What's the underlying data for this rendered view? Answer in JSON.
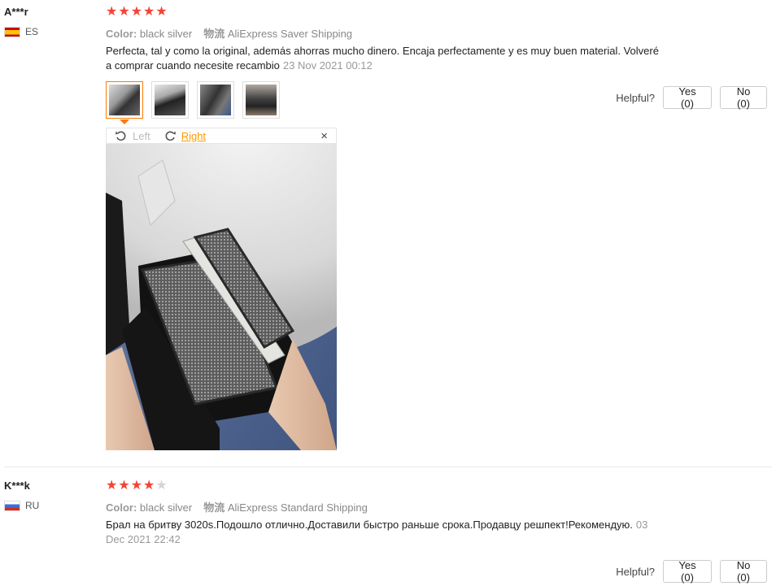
{
  "reviews": [
    {
      "user": "A***r",
      "country": "ES",
      "stars": "★★★★★",
      "stars_off": "",
      "rating": 5,
      "color_label": "Color:",
      "color_value": "black silver",
      "shipping_label": "物流",
      "shipping_value": "AliExpress Saver Shipping",
      "text_line1": "Perfecta, tal y como la original, además ahorras mucho dinero. Encaja perfectamente y es muy buen material. Volveré",
      "text_line2": "a comprar cuando necesite recambio",
      "date": "23 Nov 2021 00:12",
      "helpful_label": "Helpful?",
      "yes_label": "Yes (0)",
      "no_label": "No (0)",
      "viewer": {
        "left_label": "Left",
        "right_label": "Right",
        "close": "×"
      }
    },
    {
      "user": "K***k",
      "country": "RU",
      "stars": "★★★★",
      "stars_off": "★",
      "rating": 4,
      "color_label": "Color:",
      "color_value": "black silver",
      "shipping_label": "物流",
      "shipping_value": "AliExpress Standard Shipping",
      "text_line1": "Брал на бритву 3020s.Подошло отлично.Доставили быстро раньше срока.Продавцу решпект!Рекомендую.",
      "date_part1": "03",
      "date_part2": "Dec 2021 22:42",
      "helpful_label": "Helpful?",
      "yes_label": "Yes (0)",
      "no_label": "No (0)"
    }
  ],
  "colors": {
    "star": "#f44336",
    "accent": "#ff7a00",
    "link_right": "#ff9900"
  }
}
